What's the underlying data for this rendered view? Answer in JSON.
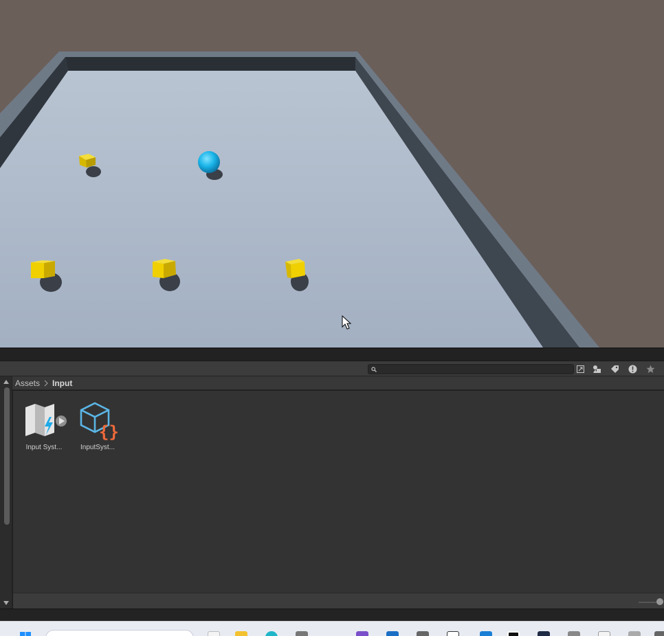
{
  "scene": {
    "objects": [
      {
        "name": "sphere-player",
        "kind": "sphere",
        "color": "#1ab4e8"
      },
      {
        "name": "cube-pickup-1",
        "kind": "cube",
        "color": "#e8c800"
      },
      {
        "name": "cube-pickup-2",
        "kind": "cube",
        "color": "#e8c800"
      },
      {
        "name": "cube-pickup-3",
        "kind": "cube",
        "color": "#e8c800"
      },
      {
        "name": "cube-pickup-4",
        "kind": "cube",
        "color": "#e8c800"
      }
    ],
    "colors": {
      "sky": "#6b5f5a",
      "floor": "#a9b6c8",
      "wall": "#5a6472",
      "wall_top": "#707b88"
    }
  },
  "project": {
    "search": {
      "value": "",
      "placeholder": ""
    },
    "toolbar_icons": [
      "open-in-window-icon",
      "filter-by-type-icon",
      "filter-by-label-icon",
      "warning-filter-icon",
      "favorite-star-icon"
    ],
    "breadcrumb": {
      "root": "Assets",
      "current": "Input"
    },
    "assets": [
      {
        "label": "Input Syst...",
        "icon": "input-actions-map-icon"
      },
      {
        "label": "InputSyst...",
        "icon": "csharp-script-icon"
      }
    ]
  }
}
